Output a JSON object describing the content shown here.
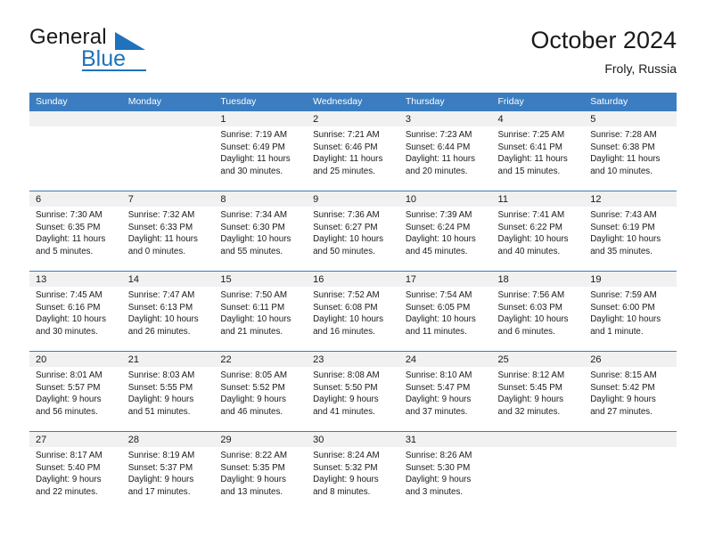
{
  "brand": {
    "name_part1": "General",
    "name_part2": "Blue",
    "accent_color": "#1f72bb"
  },
  "header": {
    "title": "October 2024",
    "subtitle": "Froly, Russia"
  },
  "calendar": {
    "header_bg": "#3b7dc0",
    "daynum_bg": "#f1f1f1",
    "weekday_headers": [
      "Sunday",
      "Monday",
      "Tuesday",
      "Wednesday",
      "Thursday",
      "Friday",
      "Saturday"
    ],
    "labels": {
      "sunrise": "Sunrise:",
      "sunset": "Sunset:",
      "daylight": "Daylight:"
    },
    "weeks": [
      [
        {
          "day": "",
          "sunrise": "",
          "sunset": "",
          "daylight_1": "",
          "daylight_2": ""
        },
        {
          "day": "",
          "sunrise": "",
          "sunset": "",
          "daylight_1": "",
          "daylight_2": ""
        },
        {
          "day": "1",
          "sunrise": "Sunrise: 7:19 AM",
          "sunset": "Sunset: 6:49 PM",
          "daylight_1": "Daylight: 11 hours",
          "daylight_2": "and 30 minutes."
        },
        {
          "day": "2",
          "sunrise": "Sunrise: 7:21 AM",
          "sunset": "Sunset: 6:46 PM",
          "daylight_1": "Daylight: 11 hours",
          "daylight_2": "and 25 minutes."
        },
        {
          "day": "3",
          "sunrise": "Sunrise: 7:23 AM",
          "sunset": "Sunset: 6:44 PM",
          "daylight_1": "Daylight: 11 hours",
          "daylight_2": "and 20 minutes."
        },
        {
          "day": "4",
          "sunrise": "Sunrise: 7:25 AM",
          "sunset": "Sunset: 6:41 PM",
          "daylight_1": "Daylight: 11 hours",
          "daylight_2": "and 15 minutes."
        },
        {
          "day": "5",
          "sunrise": "Sunrise: 7:28 AM",
          "sunset": "Sunset: 6:38 PM",
          "daylight_1": "Daylight: 11 hours",
          "daylight_2": "and 10 minutes."
        }
      ],
      [
        {
          "day": "6",
          "sunrise": "Sunrise: 7:30 AM",
          "sunset": "Sunset: 6:35 PM",
          "daylight_1": "Daylight: 11 hours",
          "daylight_2": "and 5 minutes."
        },
        {
          "day": "7",
          "sunrise": "Sunrise: 7:32 AM",
          "sunset": "Sunset: 6:33 PM",
          "daylight_1": "Daylight: 11 hours",
          "daylight_2": "and 0 minutes."
        },
        {
          "day": "8",
          "sunrise": "Sunrise: 7:34 AM",
          "sunset": "Sunset: 6:30 PM",
          "daylight_1": "Daylight: 10 hours",
          "daylight_2": "and 55 minutes."
        },
        {
          "day": "9",
          "sunrise": "Sunrise: 7:36 AM",
          "sunset": "Sunset: 6:27 PM",
          "daylight_1": "Daylight: 10 hours",
          "daylight_2": "and 50 minutes."
        },
        {
          "day": "10",
          "sunrise": "Sunrise: 7:39 AM",
          "sunset": "Sunset: 6:24 PM",
          "daylight_1": "Daylight: 10 hours",
          "daylight_2": "and 45 minutes."
        },
        {
          "day": "11",
          "sunrise": "Sunrise: 7:41 AM",
          "sunset": "Sunset: 6:22 PM",
          "daylight_1": "Daylight: 10 hours",
          "daylight_2": "and 40 minutes."
        },
        {
          "day": "12",
          "sunrise": "Sunrise: 7:43 AM",
          "sunset": "Sunset: 6:19 PM",
          "daylight_1": "Daylight: 10 hours",
          "daylight_2": "and 35 minutes."
        }
      ],
      [
        {
          "day": "13",
          "sunrise": "Sunrise: 7:45 AM",
          "sunset": "Sunset: 6:16 PM",
          "daylight_1": "Daylight: 10 hours",
          "daylight_2": "and 30 minutes."
        },
        {
          "day": "14",
          "sunrise": "Sunrise: 7:47 AM",
          "sunset": "Sunset: 6:13 PM",
          "daylight_1": "Daylight: 10 hours",
          "daylight_2": "and 26 minutes."
        },
        {
          "day": "15",
          "sunrise": "Sunrise: 7:50 AM",
          "sunset": "Sunset: 6:11 PM",
          "daylight_1": "Daylight: 10 hours",
          "daylight_2": "and 21 minutes."
        },
        {
          "day": "16",
          "sunrise": "Sunrise: 7:52 AM",
          "sunset": "Sunset: 6:08 PM",
          "daylight_1": "Daylight: 10 hours",
          "daylight_2": "and 16 minutes."
        },
        {
          "day": "17",
          "sunrise": "Sunrise: 7:54 AM",
          "sunset": "Sunset: 6:05 PM",
          "daylight_1": "Daylight: 10 hours",
          "daylight_2": "and 11 minutes."
        },
        {
          "day": "18",
          "sunrise": "Sunrise: 7:56 AM",
          "sunset": "Sunset: 6:03 PM",
          "daylight_1": "Daylight: 10 hours",
          "daylight_2": "and 6 minutes."
        },
        {
          "day": "19",
          "sunrise": "Sunrise: 7:59 AM",
          "sunset": "Sunset: 6:00 PM",
          "daylight_1": "Daylight: 10 hours",
          "daylight_2": "and 1 minute."
        }
      ],
      [
        {
          "day": "20",
          "sunrise": "Sunrise: 8:01 AM",
          "sunset": "Sunset: 5:57 PM",
          "daylight_1": "Daylight: 9 hours",
          "daylight_2": "and 56 minutes."
        },
        {
          "day": "21",
          "sunrise": "Sunrise: 8:03 AM",
          "sunset": "Sunset: 5:55 PM",
          "daylight_1": "Daylight: 9 hours",
          "daylight_2": "and 51 minutes."
        },
        {
          "day": "22",
          "sunrise": "Sunrise: 8:05 AM",
          "sunset": "Sunset: 5:52 PM",
          "daylight_1": "Daylight: 9 hours",
          "daylight_2": "and 46 minutes."
        },
        {
          "day": "23",
          "sunrise": "Sunrise: 8:08 AM",
          "sunset": "Sunset: 5:50 PM",
          "daylight_1": "Daylight: 9 hours",
          "daylight_2": "and 41 minutes."
        },
        {
          "day": "24",
          "sunrise": "Sunrise: 8:10 AM",
          "sunset": "Sunset: 5:47 PM",
          "daylight_1": "Daylight: 9 hours",
          "daylight_2": "and 37 minutes."
        },
        {
          "day": "25",
          "sunrise": "Sunrise: 8:12 AM",
          "sunset": "Sunset: 5:45 PM",
          "daylight_1": "Daylight: 9 hours",
          "daylight_2": "and 32 minutes."
        },
        {
          "day": "26",
          "sunrise": "Sunrise: 8:15 AM",
          "sunset": "Sunset: 5:42 PM",
          "daylight_1": "Daylight: 9 hours",
          "daylight_2": "and 27 minutes."
        }
      ],
      [
        {
          "day": "27",
          "sunrise": "Sunrise: 8:17 AM",
          "sunset": "Sunset: 5:40 PM",
          "daylight_1": "Daylight: 9 hours",
          "daylight_2": "and 22 minutes."
        },
        {
          "day": "28",
          "sunrise": "Sunrise: 8:19 AM",
          "sunset": "Sunset: 5:37 PM",
          "daylight_1": "Daylight: 9 hours",
          "daylight_2": "and 17 minutes."
        },
        {
          "day": "29",
          "sunrise": "Sunrise: 8:22 AM",
          "sunset": "Sunset: 5:35 PM",
          "daylight_1": "Daylight: 9 hours",
          "daylight_2": "and 13 minutes."
        },
        {
          "day": "30",
          "sunrise": "Sunrise: 8:24 AM",
          "sunset": "Sunset: 5:32 PM",
          "daylight_1": "Daylight: 9 hours",
          "daylight_2": "and 8 minutes."
        },
        {
          "day": "31",
          "sunrise": "Sunrise: 8:26 AM",
          "sunset": "Sunset: 5:30 PM",
          "daylight_1": "Daylight: 9 hours",
          "daylight_2": "and 3 minutes."
        },
        {
          "day": "",
          "sunrise": "",
          "sunset": "",
          "daylight_1": "",
          "daylight_2": ""
        },
        {
          "day": "",
          "sunrise": "",
          "sunset": "",
          "daylight_1": "",
          "daylight_2": ""
        }
      ]
    ]
  }
}
